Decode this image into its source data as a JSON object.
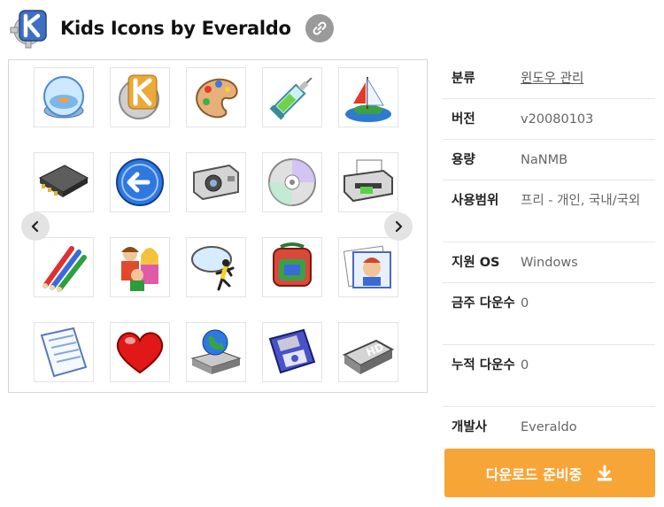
{
  "header": {
    "title": "Kids Icons by Everaldo",
    "logo_icon": "kde-gear-logo-icon",
    "share_icon": "link-icon"
  },
  "gallery": {
    "prev_icon": "chevron-left-icon",
    "next_icon": "chevron-right-icon",
    "icons": [
      "fishbowl-icon",
      "kde-gear-icon",
      "paint-palette-icon",
      "syringe-icon",
      "sailboat-icon",
      "memory-chip-icon",
      "back-arrow-icon",
      "camera-icon",
      "cd-disc-icon",
      "printer-icon",
      "colored-pencils-icon",
      "family-users-icon",
      "aim-chat-icon",
      "school-backpack-icon",
      "photo-frame-icon",
      "text-document-icon",
      "heart-icon",
      "network-drive-icon",
      "floppy-disk-icon",
      "hard-drive-icon"
    ]
  },
  "info": {
    "rows": [
      {
        "key": "분류",
        "value": "윈도우 관리"
      },
      {
        "key": "버전",
        "value": "v20080103"
      },
      {
        "key": "용량",
        "value": "NaNMB"
      },
      {
        "key": "사용범위",
        "value": "프리 - 개인, 국내/국외"
      },
      {
        "key": "지원 OS",
        "value": "Windows"
      },
      {
        "key": "금주 다운수",
        "value": "0"
      },
      {
        "key": "누적 다운수",
        "value": "0"
      },
      {
        "key": "개발사",
        "value": "Everaldo"
      }
    ]
  },
  "download": {
    "label": "다운로드 준비중",
    "icon": "download-icon",
    "color": "#f7a537"
  }
}
